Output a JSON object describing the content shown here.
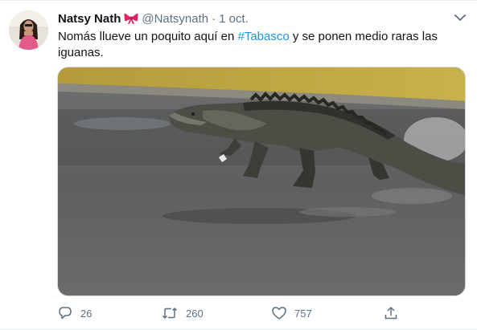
{
  "tweet": {
    "display_name": "Natsy Nath",
    "handle": "@Natsynath",
    "separator": "·",
    "date": "1 oct.",
    "text_before": "Nomás llueve un poquito aquí en ",
    "hashtag": "#Tabasco",
    "text_after": " y se ponen medio raras las iguanas.",
    "icons": {
      "name_emoji": "ribbon-bow-icon",
      "menu": "chevron-down-icon"
    },
    "image": {
      "subject": "crocodile walking on wet road"
    },
    "actions": {
      "replies": "26",
      "retweets": "260",
      "likes": "757"
    }
  },
  "colors": {
    "text": "#0f1419",
    "secondary": "#5b7083",
    "hashtag": "#1b95e0",
    "bow": "#e0245e",
    "border": "#ebeef0"
  }
}
